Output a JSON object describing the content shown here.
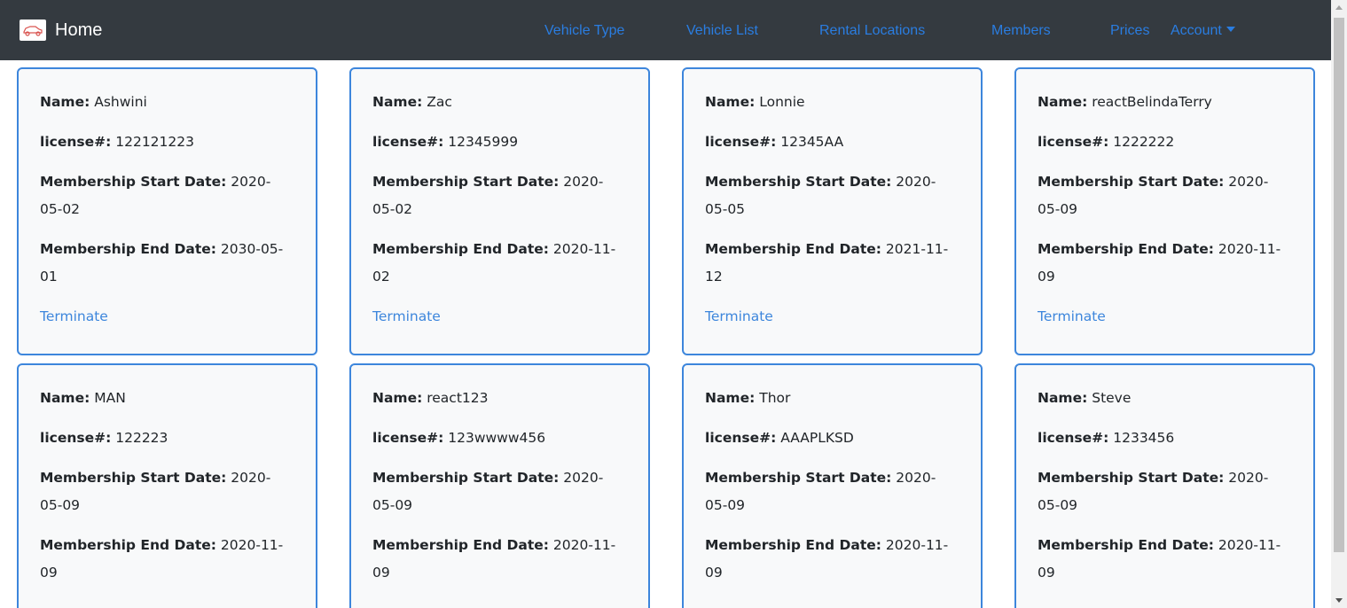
{
  "navbar": {
    "brand": "Home",
    "brand_icon": "car-logo-icon",
    "links": [
      "Vehicle Type",
      "Vehicle List",
      "Rental Locations",
      "Members",
      "Prices"
    ],
    "account": "Account",
    "link_color": "#2a7de1",
    "background": "#343a40"
  },
  "labels": {
    "name": "Name:",
    "license": "license#:",
    "start": "Membership Start Date:",
    "end": "Membership End Date:",
    "terminate": "Terminate"
  },
  "members": [
    {
      "name": "Ashwini",
      "license": "122121223",
      "start_a": "2020-",
      "start_b": "05-02",
      "end_a": "2030-05-",
      "end_b": "01"
    },
    {
      "name": "Zac",
      "license": "12345999",
      "start_a": "2020-",
      "start_b": "05-02",
      "end_a": "2020-11-",
      "end_b": "02"
    },
    {
      "name": "Lonnie",
      "license": "12345AA",
      "start_a": "2020-",
      "start_b": "05-05",
      "end_a": "2021-11-",
      "end_b": "12"
    },
    {
      "name": "reactBelindaTerry",
      "license": "1222222",
      "start_a": "2020-",
      "start_b": "05-09",
      "end_a": "2020-11-",
      "end_b": "09"
    },
    {
      "name": "MAN",
      "license": "122223",
      "start_a": "2020-",
      "start_b": "05-09",
      "end_a": "2020-11-",
      "end_b": "09"
    },
    {
      "name": "react123",
      "license": "123wwww456",
      "start_a": "2020-",
      "start_b": "05-09",
      "end_a": "2020-11-",
      "end_b": "09"
    },
    {
      "name": "Thor",
      "license": "AAAPLKSD",
      "start_a": "2020-",
      "start_b": "05-09",
      "end_a": "2020-11-",
      "end_b": "09"
    },
    {
      "name": "Steve",
      "license": "1233456",
      "start_a": "2020-",
      "start_b": "05-09",
      "end_a": "2020-11-",
      "end_b": "09"
    }
  ],
  "card_border_color": "#3d86dc"
}
